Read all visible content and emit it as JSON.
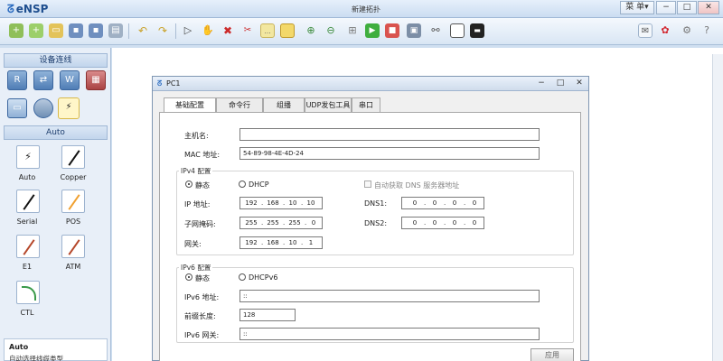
{
  "app": {
    "logo": "eNSP",
    "window_title": "新建拓扑",
    "menu_label": "菜 单▾"
  },
  "toolbar": {
    "icons": [
      "new-topology",
      "new-lab",
      "open",
      "save",
      "save-as",
      "print",
      "undo",
      "redo",
      "select",
      "pan",
      "delete",
      "delete-links",
      "text",
      "rectangle",
      "zoom-in",
      "zoom-out",
      "start-devices",
      "stop-devices",
      "capture",
      "topology",
      "fit",
      "screenshot"
    ],
    "right_icons": [
      "chat",
      "huawei",
      "settings",
      "help"
    ]
  },
  "left_panel": {
    "device_header": "设备连线",
    "category_header": "Auto",
    "cables": [
      {
        "label": "Auto"
      },
      {
        "label": "Copper"
      },
      {
        "label": "Serial"
      },
      {
        "label": "POS"
      },
      {
        "label": "E1"
      },
      {
        "label": "ATM"
      },
      {
        "label": "CTL"
      }
    ],
    "desc_title": "Auto",
    "desc_text": "自动选择线缆类型"
  },
  "dialog": {
    "title": "PC1",
    "tabs": [
      "基础配置",
      "命令行",
      "组播",
      "UDP发包工具",
      "串口"
    ],
    "active_tab": 0,
    "hostname_label": "主机名:",
    "hostname_value": "",
    "mac_label": "MAC 地址:",
    "mac_value": "54-89-98-4E-4D-24",
    "ipv4": {
      "group_title": "IPv4 配置",
      "static_label": "静态",
      "dhcp_label": "DHCP",
      "auto_dns_label": "自动获取 DNS 服务器地址",
      "ip_label": "IP 地址:",
      "ip": [
        "192",
        "168",
        "10",
        "10"
      ],
      "mask_label": "子网掩码:",
      "mask": [
        "255",
        "255",
        "255",
        "0"
      ],
      "gateway_label": "网关:",
      "gateway": [
        "192",
        "168",
        "10",
        "1"
      ],
      "dns1_label": "DNS1:",
      "dns1": [
        "0",
        "0",
        "0",
        "0"
      ],
      "dns2_label": "DNS2:",
      "dns2": [
        "0",
        "0",
        "0",
        "0"
      ]
    },
    "ipv6": {
      "group_title": "IPv6 配置",
      "static_label": "静态",
      "dhcp_label": "DHCPv6",
      "ip_label": "IPv6 地址:",
      "ip_value": "::",
      "prefix_label": "前缀长度:",
      "prefix_value": "128",
      "gateway_label": "IPv6 网关:",
      "gateway_value": "::"
    },
    "apply_label": "应用"
  }
}
